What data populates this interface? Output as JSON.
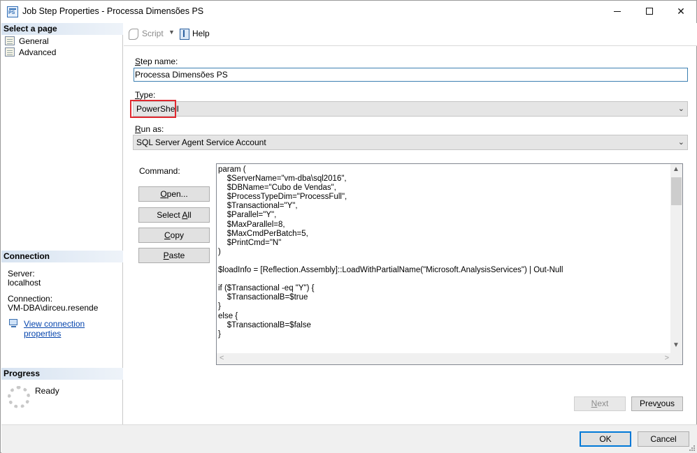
{
  "window": {
    "title": "Job Step Properties - Processa Dimensões PS"
  },
  "sidebar": {
    "select_page_header": "Select a page",
    "pages": [
      {
        "label": "General"
      },
      {
        "label": "Advanced"
      }
    ],
    "connection_header": "Connection",
    "server_label": "Server:",
    "server_value": "localhost",
    "connection_label": "Connection:",
    "connection_value": "VM-DBA\\dirceu.resende",
    "view_connection_link": "View connection properties",
    "progress_header": "Progress",
    "progress_status": "Ready"
  },
  "toolbar": {
    "script_label": "Script",
    "help_label": "Help"
  },
  "form": {
    "step_name_label": "Step name:",
    "step_name_value": "Processa Dimensões PS",
    "type_label": "Type:",
    "type_value": "PowerShell",
    "run_as_label": "Run as:",
    "run_as_value": "SQL Server Agent Service Account",
    "command_label": "Command:",
    "buttons": {
      "open": "Open...",
      "select_all": "Select All",
      "copy": "Copy",
      "paste": "Paste"
    },
    "command_text": "param (\n    $ServerName=\"vm-dba\\sql2016\",\n    $DBName=\"Cubo de Vendas\",\n    $ProcessTypeDim=\"ProcessFull\",\n    $Transactional=\"Y\",\n    $Parallel=\"Y\",\n    $MaxParallel=8,\n    $MaxCmdPerBatch=5,\n    $PrintCmd=\"N\"\n)\n\n$loadInfo = [Reflection.Assembly]::LoadWithPartialName(\"Microsoft.AnalysisServices\") | Out-Null\n\nif ($Transactional -eq \"Y\") {\n    $TransactionalB=$true\n}\nelse {\n    $TransactionalB=$false\n}"
  },
  "nav": {
    "next_label": "Next",
    "previous_label": "Previous"
  },
  "footer": {
    "ok_label": "OK",
    "cancel_label": "Cancel"
  }
}
